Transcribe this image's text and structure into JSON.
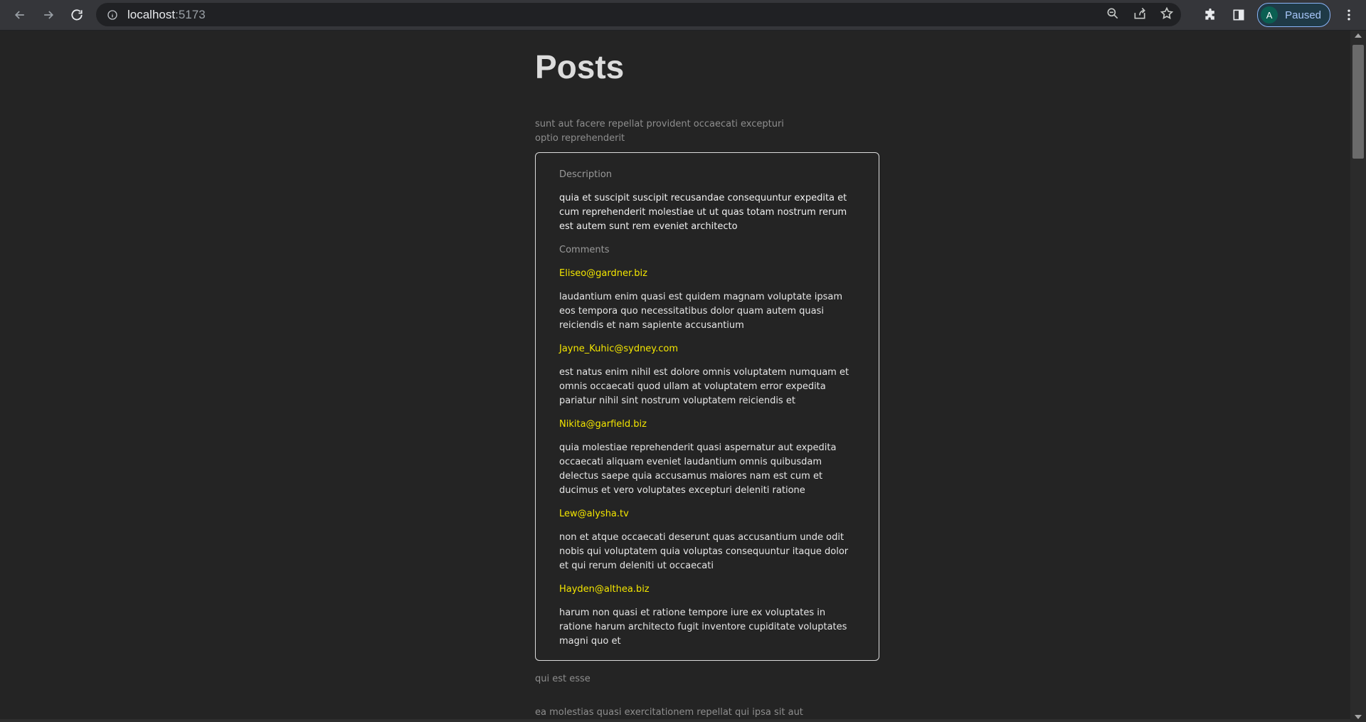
{
  "browser": {
    "url_host": "localhost",
    "url_port": ":5173",
    "profile_initial": "A",
    "profile_status": "Paused",
    "icons": [
      "back-icon",
      "forward-icon",
      "reload-icon",
      "info-icon",
      "zoom-icon",
      "share-icon",
      "star-icon",
      "extensions-icon",
      "sidebar-icon",
      "menu-icon"
    ]
  },
  "page": {
    "title": "Posts",
    "posts": [
      {
        "title": "sunt aut facere repellat provident occaecati excepturi optio reprehenderit",
        "description_label": "Description",
        "description": "quia et suscipit suscipit recusandae consequuntur expedita et cum reprehenderit molestiae ut ut quas totam nostrum rerum est autem sunt rem eveniet architecto",
        "comments_label": "Comments",
        "comments": [
          {
            "email": "Eliseo@gardner.biz",
            "body": "laudantium enim quasi est quidem magnam voluptate ipsam eos tempora quo necessitatibus dolor quam autem quasi reiciendis et nam sapiente accusantium"
          },
          {
            "email": "Jayne_Kuhic@sydney.com",
            "body": "est natus enim nihil est dolore omnis voluptatem numquam et omnis occaecati quod ullam at voluptatem error expedita pariatur nihil sint nostrum voluptatem reiciendis et"
          },
          {
            "email": "Nikita@garfield.biz",
            "body": "quia molestiae reprehenderit quasi aspernatur aut expedita occaecati aliquam eveniet laudantium omnis quibusdam delectus saepe quia accusamus maiores nam est cum et ducimus et vero voluptates excepturi deleniti ratione"
          },
          {
            "email": "Lew@alysha.tv",
            "body": "non et atque occaecati deserunt quas accusantium unde odit nobis qui voluptatem quia voluptas consequuntur itaque dolor et qui rerum deleniti ut occaecati"
          },
          {
            "email": "Hayden@althea.biz",
            "body": "harum non quasi et ratione tempore iure ex voluptates in ratione harum architecto fugit inventore cupiditate voluptates magni quo et"
          }
        ]
      },
      {
        "title": "qui est esse"
      },
      {
        "title": "ea molestias quasi exercitationem repellat qui ipsa sit aut"
      }
    ]
  },
  "colors": {
    "background": "#242424",
    "email": "#f4e600",
    "card_border": "#dcdcdc"
  }
}
